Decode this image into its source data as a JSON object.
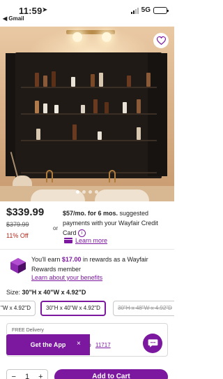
{
  "status_bar": {
    "time": "11:59",
    "back_app": "◀ Gmail",
    "network": "5G"
  },
  "product": {
    "image_dots": 4,
    "active_dot": 1,
    "price": "$339.99",
    "was_price": "$379.99",
    "discount": "11% Off"
  },
  "financing": {
    "or": "or",
    "amount": "$57/mo. for 6 mos.",
    "text": " suggested payments with your Wayfair Credit Card ",
    "learn_more": "Learn more"
  },
  "rewards": {
    "prefix": "You'll earn ",
    "amount": "$17.00",
    "suffix": " in rewards as a Wayfair Rewards member",
    "link": "Learn about your benefits"
  },
  "size": {
    "label": "Size: ",
    "selected": "30\"H x 40\"W x 4.92\"D",
    "options": [
      "\"W x 4.92\"D",
      "30\"H x 40\"W x 4.92\"D",
      "30\"H x 48\"W x 4.92\"D"
    ]
  },
  "shipping": {
    "free": "FREE Delivery",
    "to": "to",
    "zip": "11717"
  },
  "app_banner": {
    "label": "Get the App",
    "close": "×"
  },
  "cart": {
    "minus": "−",
    "qty": "1",
    "plus": "+",
    "add_label": "Add to Cart"
  },
  "colors": {
    "brand": "#7b189f",
    "sale": "#b22a1e"
  }
}
